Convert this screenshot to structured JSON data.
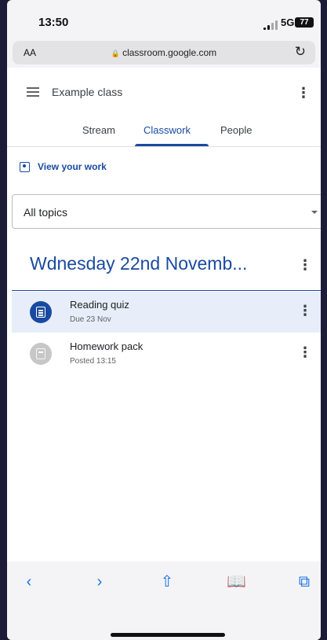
{
  "status": {
    "time": "13:50",
    "network": "5G",
    "battery": "77"
  },
  "browser": {
    "text_size": "AA",
    "url": "classroom.google.com"
  },
  "header": {
    "class_name": "Example class"
  },
  "tabs": [
    {
      "label": "Stream"
    },
    {
      "label": "Classwork"
    },
    {
      "label": "People"
    }
  ],
  "view_work": {
    "label": "View your work"
  },
  "topics": {
    "selected": "All topics"
  },
  "section": {
    "title": "Wdnesday 22nd Novemb..."
  },
  "items": [
    {
      "title": "Reading quiz",
      "subtitle": "Due 23 Nov",
      "icon": "assignment-icon"
    },
    {
      "title": "Homework pack",
      "subtitle": "Posted 13:15",
      "icon": "material-icon"
    }
  ],
  "colors": {
    "accent": "#1a4aa0",
    "selected_row": "#e7eefa",
    "frame": "#1d1c38"
  }
}
